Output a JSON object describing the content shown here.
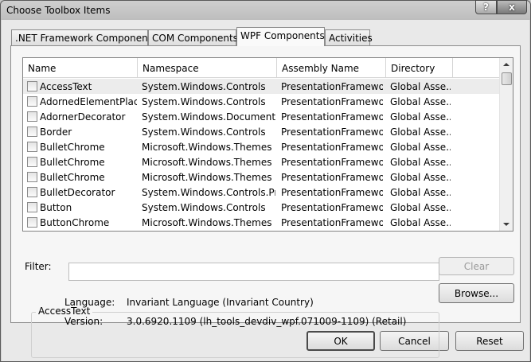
{
  "window": {
    "title": "Choose Toolbox Items",
    "help_label": "?",
    "close_label": "x"
  },
  "tabs": [
    {
      "label": ".NET Framework Components",
      "active": false
    },
    {
      "label": "COM Components",
      "active": false
    },
    {
      "label": "WPF Components",
      "active": true
    },
    {
      "label": "Activities",
      "active": false
    }
  ],
  "list": {
    "columns": [
      "Name",
      "Namespace",
      "Assembly Name",
      "Directory"
    ],
    "rows": [
      {
        "name": "AccessText",
        "namespace": "System.Windows.Controls",
        "assembly": "PresentationFramewo...",
        "directory": "Global Asse...",
        "checked": false,
        "selected": true
      },
      {
        "name": "AdornedElementPlac...",
        "namespace": "System.Windows.Controls",
        "assembly": "PresentationFramewo...",
        "directory": "Global Asse...",
        "checked": false,
        "selected": false
      },
      {
        "name": "AdornerDecorator",
        "namespace": "System.Windows.Documents",
        "assembly": "PresentationFramewo...",
        "directory": "Global Asse...",
        "checked": false,
        "selected": false
      },
      {
        "name": "Border",
        "namespace": "System.Windows.Controls",
        "assembly": "PresentationFramewo...",
        "directory": "Global Asse...",
        "checked": false,
        "selected": false
      },
      {
        "name": "BulletChrome",
        "namespace": "Microsoft.Windows.Themes",
        "assembly": "PresentationFramewo...",
        "directory": "Global Asse...",
        "checked": false,
        "selected": false
      },
      {
        "name": "BulletChrome",
        "namespace": "Microsoft.Windows.Themes",
        "assembly": "PresentationFramewo...",
        "directory": "Global Asse...",
        "checked": false,
        "selected": false
      },
      {
        "name": "BulletChrome",
        "namespace": "Microsoft.Windows.Themes",
        "assembly": "PresentationFramewo...",
        "directory": "Global Asse...",
        "checked": false,
        "selected": false
      },
      {
        "name": "BulletDecorator",
        "namespace": "System.Windows.Controls.Pr...",
        "assembly": "PresentationFramewo...",
        "directory": "Global Asse...",
        "checked": false,
        "selected": false
      },
      {
        "name": "Button",
        "namespace": "System.Windows.Controls",
        "assembly": "PresentationFramewo...",
        "directory": "Global Asse...",
        "checked": false,
        "selected": false
      },
      {
        "name": "ButtonChrome",
        "namespace": "Microsoft.Windows.Themes",
        "assembly": "PresentationFramewo...",
        "directory": "Global Asse...",
        "checked": false,
        "selected": false
      }
    ]
  },
  "filter": {
    "label": "Filter:",
    "value": "",
    "clear_label": "Clear"
  },
  "details": {
    "title": "AccessText",
    "language_label": "Language:",
    "language_value": "Invariant Language (Invariant Country)",
    "version_label": "Version:",
    "version_value": "3.0.6920.1109 (lh_tools_devdiv_wpf.071009-1109) (Retail)"
  },
  "buttons": {
    "browse": "Browse...",
    "ok": "OK",
    "cancel": "Cancel",
    "reset": "Reset"
  }
}
